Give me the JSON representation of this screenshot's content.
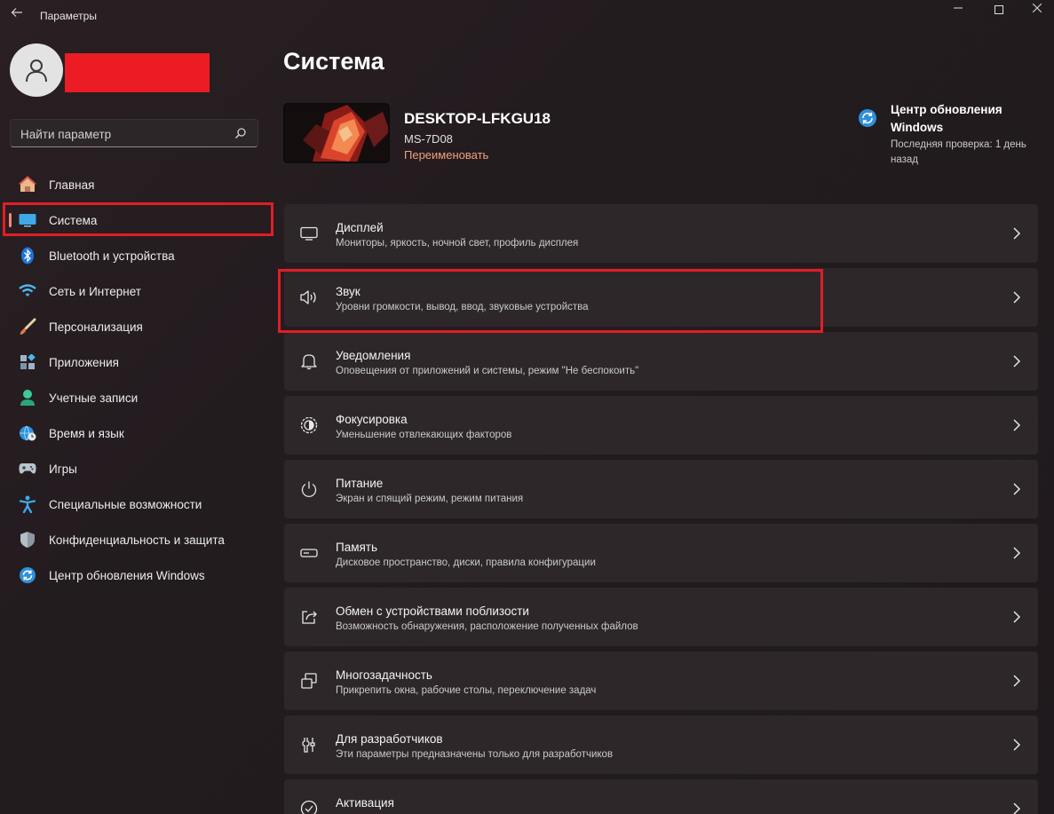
{
  "window": {
    "title": "Параметры"
  },
  "search": {
    "placeholder": "Найти параметр"
  },
  "sidebar": {
    "items": [
      {
        "label": "Главная"
      },
      {
        "label": "Система"
      },
      {
        "label": "Bluetooth и устройства"
      },
      {
        "label": "Сеть и Интернет"
      },
      {
        "label": "Персонализация"
      },
      {
        "label": "Приложения"
      },
      {
        "label": "Учетные записи"
      },
      {
        "label": "Время и язык"
      },
      {
        "label": "Игры"
      },
      {
        "label": "Специальные возможности"
      },
      {
        "label": "Конфиденциальность и защита"
      },
      {
        "label": "Центр обновления Windows"
      }
    ],
    "active_index": 1
  },
  "main": {
    "title": "Система",
    "device": {
      "name": "DESKTOP-LFKGU18",
      "model": "MS-7D08",
      "rename": "Переименовать"
    },
    "update": {
      "title": "Центр обновления Windows",
      "subtitle": "Последняя проверка: 1 день назад"
    },
    "cards": [
      {
        "title": "Дисплей",
        "subtitle": "Мониторы, яркость, ночной свет, профиль дисплея"
      },
      {
        "title": "Звук",
        "subtitle": "Уровни громкости, вывод, ввод, звуковые устройства"
      },
      {
        "title": "Уведомления",
        "subtitle": "Оповещения от приложений и системы, режим \"Не беспокоить\""
      },
      {
        "title": "Фокусировка",
        "subtitle": "Уменьшение отвлекающих факторов"
      },
      {
        "title": "Питание",
        "subtitle": "Экран и спящий режим, режим питания"
      },
      {
        "title": "Память",
        "subtitle": "Дисковое пространство, диски, правила конфигурации"
      },
      {
        "title": "Обмен с устройствами поблизости",
        "subtitle": "Возможность обнаружения, расположение полученных файлов"
      },
      {
        "title": "Многозадачность",
        "subtitle": "Прикрепить окна, рабочие столы, переключение задач"
      },
      {
        "title": "Для разработчиков",
        "subtitle": "Эти параметры предназначены только для разработчиков"
      },
      {
        "title": "Активация",
        "subtitle": ""
      }
    ]
  },
  "colors": {
    "accent_link": "#f1a07d",
    "highlight_red": "#e01e26",
    "card_bg": "#2d2729"
  }
}
